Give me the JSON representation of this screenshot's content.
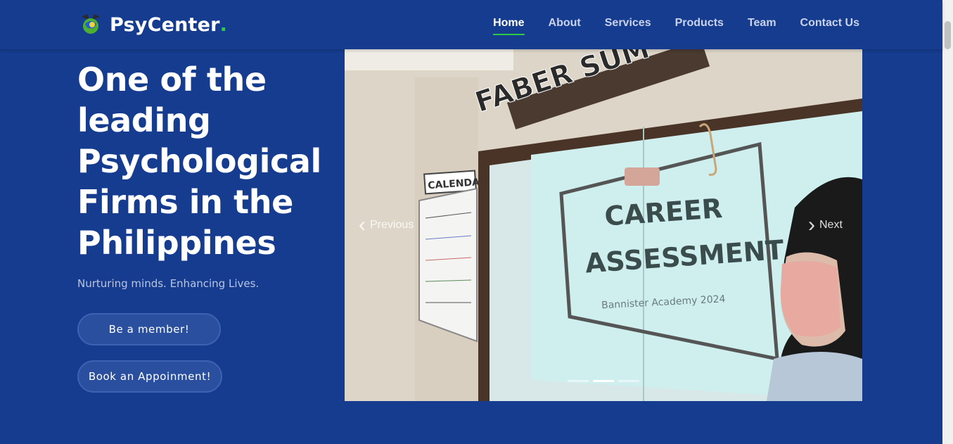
{
  "brand": {
    "name": "PsyCenter",
    "dot": "."
  },
  "nav": {
    "items": [
      {
        "label": "Home",
        "active": true
      },
      {
        "label": "About"
      },
      {
        "label": "Services"
      },
      {
        "label": "Products"
      },
      {
        "label": "Team"
      },
      {
        "label": "Contact Us"
      }
    ]
  },
  "hero": {
    "title": "One of the leading Psychological Firms in the Philippines",
    "subtitle": "Nurturing minds. Enhancing Lives.",
    "member_button": "Be a member!",
    "book_button": "Book an Appoinment!"
  },
  "carousel": {
    "prev_label": "Previous",
    "next_label": "Next",
    "slide_count": 3,
    "active_slide": 1,
    "image": {
      "banner_text": "FABER SUM",
      "calendar_text": "CALENDAR",
      "screen_title_line1": "CAREER",
      "screen_title_line2": "ASSESSMENT",
      "screen_subtitle": "Bannister Academy 2024"
    }
  },
  "colors": {
    "background": "#163c8f",
    "accent": "#2ecc40",
    "text": "#ffffff"
  }
}
